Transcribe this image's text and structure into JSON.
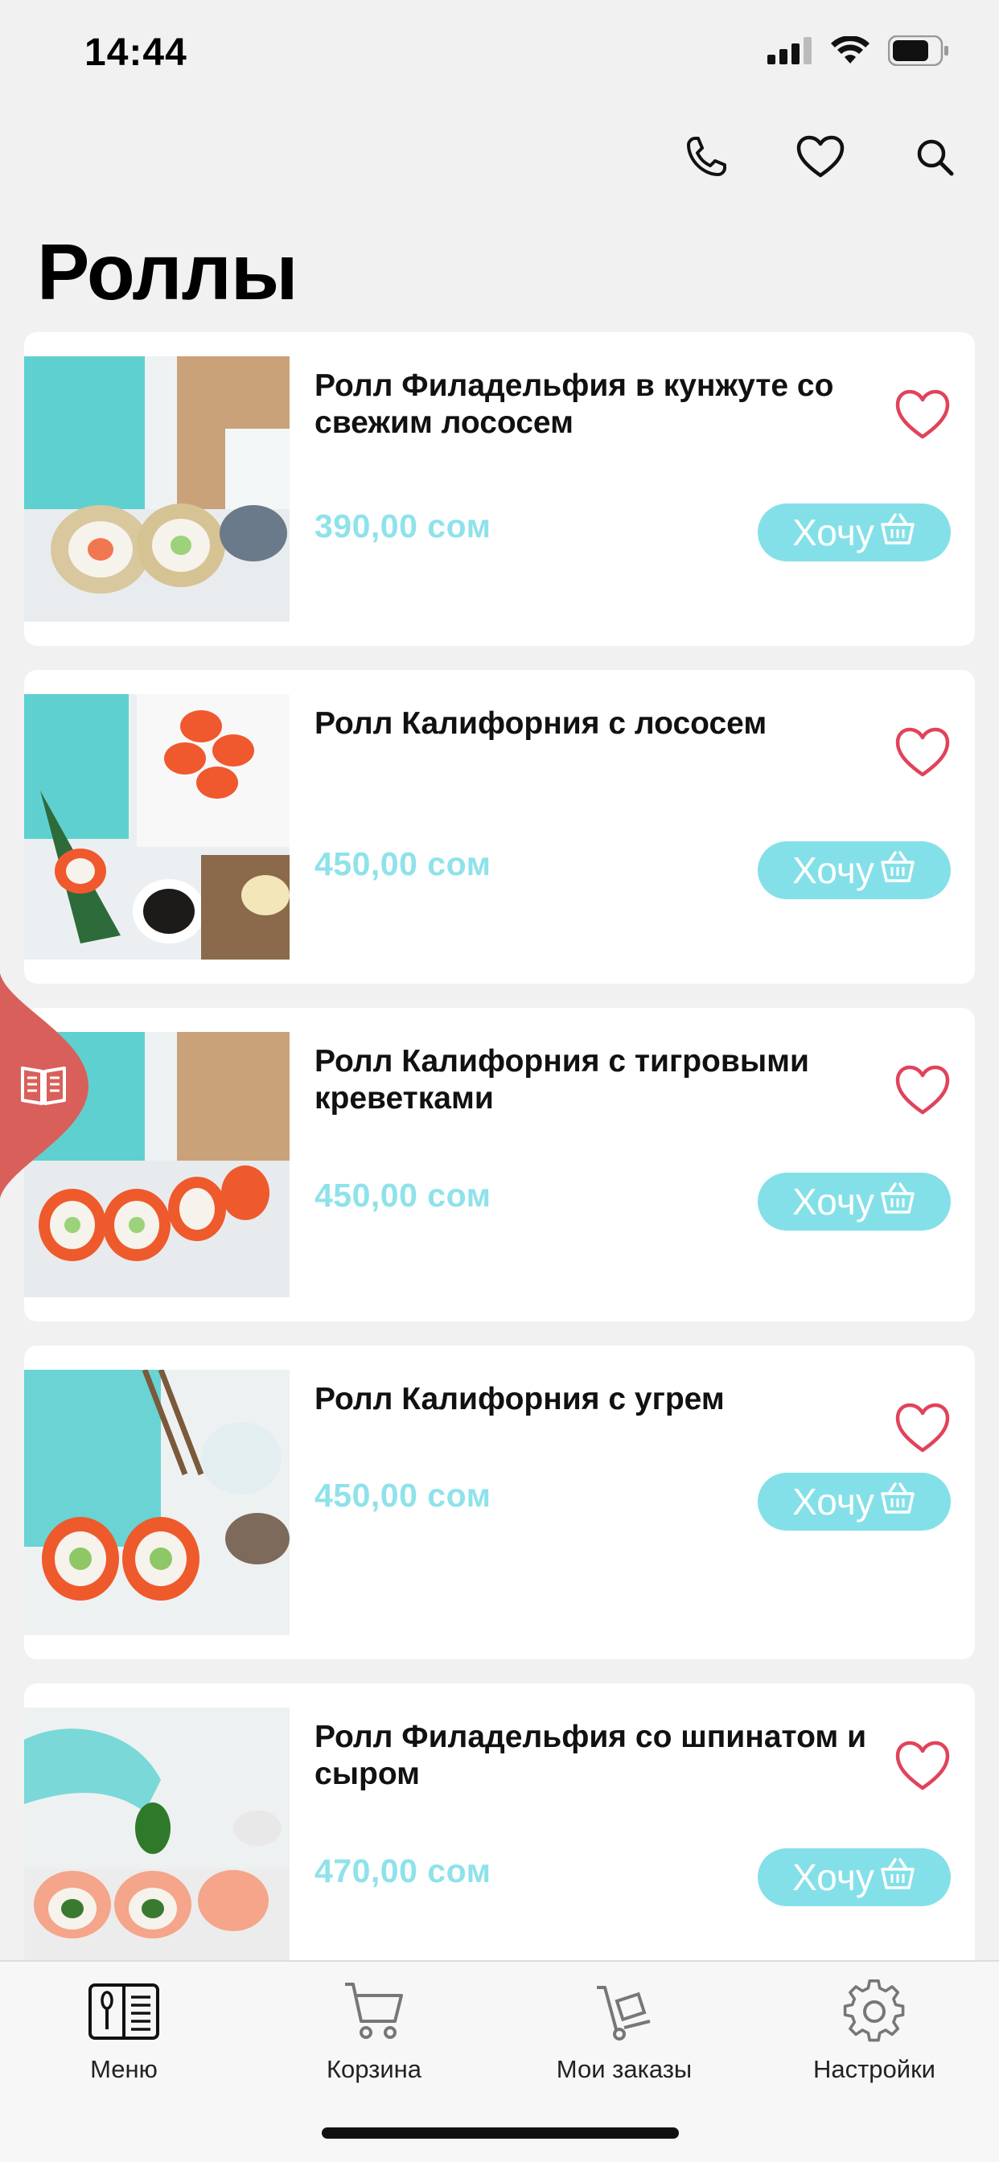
{
  "status_bar": {
    "time": "14:44"
  },
  "header": {
    "icons": [
      "phone-icon",
      "heart-icon",
      "search-icon"
    ]
  },
  "page": {
    "title": "Роллы"
  },
  "products": [
    {
      "name": "Ролл Филадельфия в кунжуте со свежим лососем",
      "price": "390,00 сом",
      "button": "Хочу"
    },
    {
      "name": "Ролл Калифорния с лососем",
      "price": "450,00 сом",
      "button": "Хочу"
    },
    {
      "name": "Ролл Калифорния с тигровыми креветками",
      "price": "450,00 сом",
      "button": "Хочу"
    },
    {
      "name": "Ролл Калифорния с угрем",
      "price": "450,00 сом",
      "button": "Хочу"
    },
    {
      "name": "Ролл Филадельфия со шпинатом и сыром",
      "price": "470,00 сом",
      "button": "Хочу"
    }
  ],
  "bottom_nav": {
    "items": [
      {
        "label": "Меню",
        "icon": "menu-book-icon"
      },
      {
        "label": "Корзина",
        "icon": "cart-icon"
      },
      {
        "label": "Мои заказы",
        "icon": "orders-icon"
      },
      {
        "label": "Настройки",
        "icon": "settings-icon"
      }
    ]
  },
  "colors": {
    "accent": "#84e0e8",
    "price": "#8fe2ea",
    "favorite": "#e0435a",
    "side_tab": "#d95f5a",
    "background": "#f1f1f2"
  }
}
